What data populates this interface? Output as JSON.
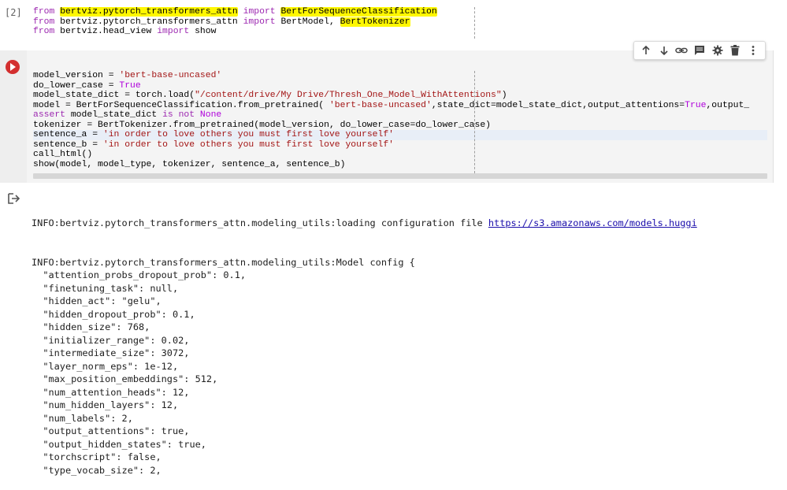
{
  "cell1": {
    "exec_count": "[2]",
    "lines": [
      [
        {
          "t": "from",
          "c": "kw"
        },
        {
          "t": " "
        },
        {
          "t": "bertviz.pytorch_transformers_attn",
          "c": "hl"
        },
        {
          "t": " "
        },
        {
          "t": "import",
          "c": "kw"
        },
        {
          "t": " "
        },
        {
          "t": "BertForSequenceClassification",
          "c": "hl"
        }
      ],
      [
        {
          "t": "from",
          "c": "kw"
        },
        {
          "t": " bertviz.pytorch_transformers_attn "
        },
        {
          "t": "import",
          "c": "kw"
        },
        {
          "t": " BertModel, "
        },
        {
          "t": "BertTokenizer",
          "c": "hl"
        }
      ],
      [
        {
          "t": "from",
          "c": "kw"
        },
        {
          "t": " bertviz.head_view "
        },
        {
          "t": "import",
          "c": "kw"
        },
        {
          "t": " show"
        }
      ]
    ]
  },
  "toolbar": {
    "icons": [
      "arrow-up-icon",
      "arrow-down-icon",
      "link-icon",
      "comment-icon",
      "settings-icon",
      "delete-icon",
      "more-icon"
    ]
  },
  "cell2": {
    "lines": [
      [
        {
          "t": "model_version = "
        },
        {
          "t": "'bert-base-uncased'",
          "c": "str"
        }
      ],
      [
        {
          "t": "do_lower_case = "
        },
        {
          "t": "True",
          "c": "bool"
        }
      ],
      [
        {
          "t": "model_state_dict = torch.load("
        },
        {
          "t": "\"/content/drive/My Drive/Thresh_One_Model_WithAttentions\"",
          "c": "str"
        },
        {
          "t": ")"
        }
      ],
      [
        {
          "t": "model = BertForSequenceClassification.from_pretrained( "
        },
        {
          "t": "'bert-base-uncased'",
          "c": "str"
        },
        {
          "t": ",state_dict=model_state_dict,output_attentions="
        },
        {
          "t": "True",
          "c": "bool"
        },
        {
          "t": ",output_"
        }
      ],
      [
        {
          "t": "assert",
          "c": "kw"
        },
        {
          "t": " model_state_dict "
        },
        {
          "t": "is not",
          "c": "kw"
        },
        {
          "t": " "
        },
        {
          "t": "None",
          "c": "bool"
        }
      ],
      [
        {
          "t": "tokenizer = BertTokenizer.from_pretrained(model_version, do_lower_case=do_lower_case)"
        }
      ],
      [
        {
          "t": "sentence_a = "
        },
        {
          "t": "'in order to love others you must first love yourself'",
          "c": "str"
        }
      ],
      [
        {
          "t": "sentence_b = "
        },
        {
          "t": "'in order to love others you must first love yourself'",
          "c": "str"
        }
      ],
      [
        {
          "t": "call_html()"
        }
      ],
      [
        {
          "t": "show(model, model_type, tokenizer, sentence_a, sentence_b)"
        }
      ]
    ]
  },
  "output": {
    "line1_prefix": "INFO:bertviz.pytorch_transformers_attn.modeling_utils:loading configuration file ",
    "line1_link": "https://s3.amazonaws.com/models.huggi",
    "lines": [
      "INFO:bertviz.pytorch_transformers_attn.modeling_utils:Model config {",
      "  \"attention_probs_dropout_prob\": 0.1,",
      "  \"finetuning_task\": null,",
      "  \"hidden_act\": \"gelu\",",
      "  \"hidden_dropout_prob\": 0.1,",
      "  \"hidden_size\": 768,",
      "  \"initializer_range\": 0.02,",
      "  \"intermediate_size\": 3072,",
      "  \"layer_norm_eps\": 1e-12,",
      "  \"max_position_embeddings\": 512,",
      "  \"num_attention_heads\": 12,",
      "  \"num_hidden_layers\": 12,",
      "  \"num_labels\": 2,",
      "  \"output_attentions\": true,",
      "  \"output_hidden_states\": true,",
      "  \"torchscript\": false,",
      "  \"type_vocab_size\": 2,"
    ]
  }
}
